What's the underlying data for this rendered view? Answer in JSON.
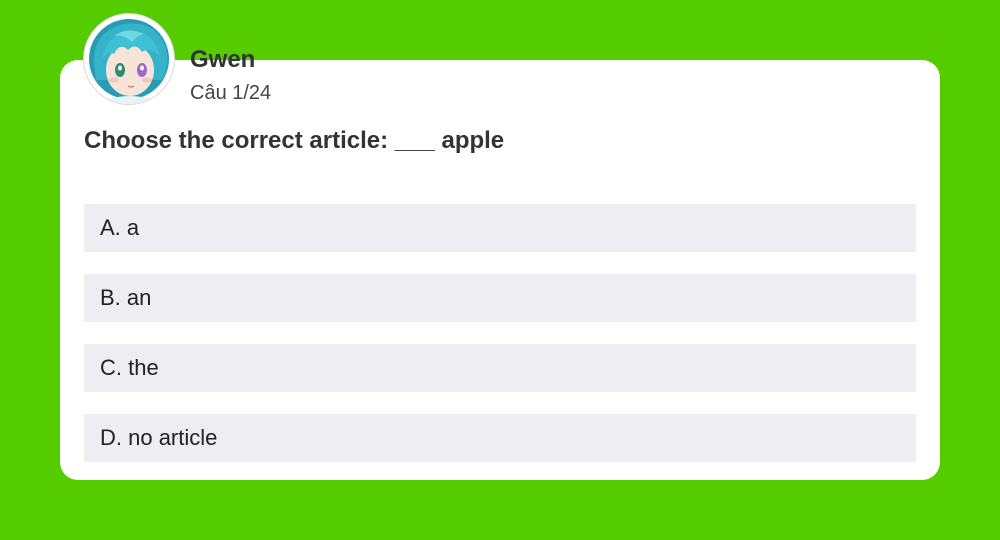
{
  "user": {
    "name": "Gwen",
    "avatar_icon": "anime-character-avatar"
  },
  "quiz": {
    "counter": "Câu 1/24",
    "question": "Choose the correct article: ___ apple",
    "options": [
      {
        "label": "A. a"
      },
      {
        "label": "B. an"
      },
      {
        "label": "C. the"
      },
      {
        "label": "D. no article"
      }
    ]
  },
  "colors": {
    "background": "#55cc00",
    "card": "#ffffff",
    "option_background": "#ededf2",
    "text_dark": "#333333"
  }
}
